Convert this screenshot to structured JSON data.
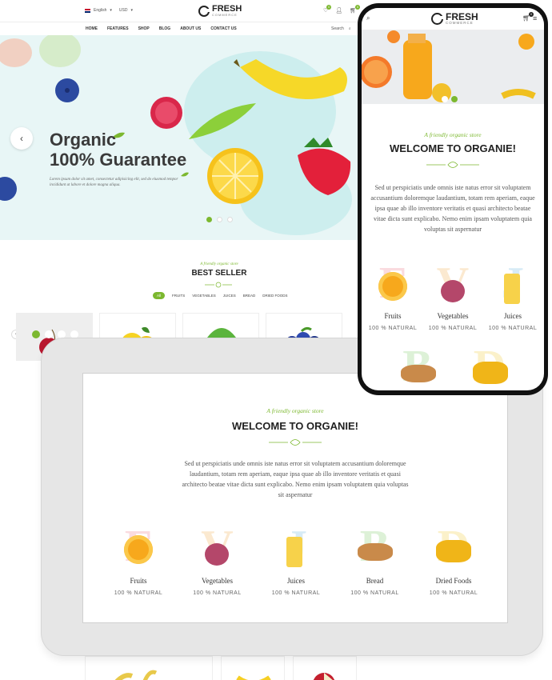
{
  "brand": {
    "name": "FRESH",
    "sub": "COMMERCE",
    "accent": "#7cb82f"
  },
  "topbar": {
    "language": "English",
    "currency": "USD",
    "wishlist_count": "0",
    "cart_count": "0"
  },
  "nav": {
    "items": [
      "HOME",
      "FEATURES",
      "SHOP",
      "BLOG",
      "ABOUT US",
      "CONTACT US"
    ],
    "search_label": "Search"
  },
  "hero": {
    "title_line1": "Organic",
    "title_line2": "100% Guarantee",
    "text": "Lorem ipsum dolor sit amet, consectetur adipisicing elit, sed do eiusmod tempor incididunt ut labore et dolore magna aliqua.",
    "slides": 3,
    "active_slide": 1
  },
  "best_seller": {
    "tagline": "A friendly organic store",
    "title": "BEST SELLER",
    "tabs": [
      "All",
      "FRUITS",
      "VEGETABLES",
      "JUICES",
      "BREAD",
      "DRIED FOODS"
    ],
    "active_tab": "All"
  },
  "welcome": {
    "tagline": "A friendly organic store",
    "title": "WELCOME TO ORGANIE!",
    "text": "Sed ut perspiciatis unde omnis iste natus error sit voluptatem accusantium doloremque laudantium, totam rem aperiam, eaque ipsa quae ab illo inventore veritatis et quasi architecto beatae vitae dicta sunt explicabo. Nemo enim ipsam voluptatem quia voluptas sit aspernatur"
  },
  "categories": [
    {
      "letter": "F",
      "name": "Fruits",
      "note": "100 % NATURAL",
      "letter_color": "#f29aa5"
    },
    {
      "letter": "V",
      "name": "Vegetables",
      "note": "100 % NATURAL",
      "letter_color": "#f5c37a"
    },
    {
      "letter": "J",
      "name": "Juices",
      "note": "100 % NATURAL",
      "letter_color": "#8fc8e8"
    },
    {
      "letter": "B",
      "name": "Bread",
      "note": "100 % NATURAL",
      "letter_color": "#9fd98f"
    },
    {
      "letter": "D",
      "name": "Dried Foods",
      "note": "100 % NATURAL",
      "letter_color": "#f5d96a"
    }
  ]
}
